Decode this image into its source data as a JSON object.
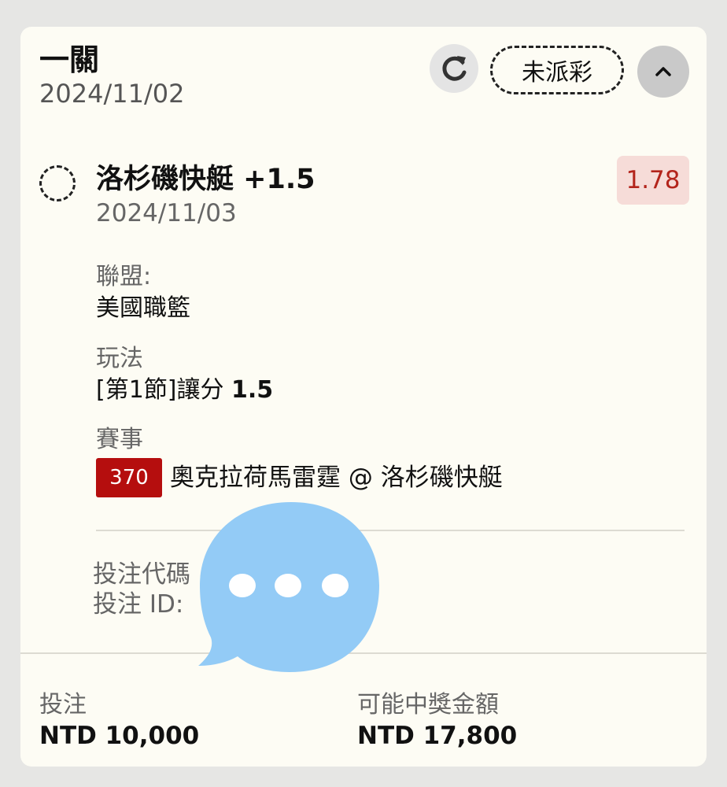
{
  "header": {
    "title": "一關",
    "date": "2024/11/02",
    "status_label": "未派彩",
    "icons": [
      "refresh-icon",
      "chevron-up-icon"
    ]
  },
  "selection": {
    "title": "洛杉磯快艇 +1.5",
    "date": "2024/11/03",
    "odds": "1.78",
    "league_label": "聯盟:",
    "league_value": "美國職籃",
    "bet_type_label": "玩法",
    "bet_type_prefix": "[第1節]讓分 ",
    "bet_type_line": "1.5",
    "event_label": "賽事",
    "event_number": "370",
    "event_name": "奧克拉荷馬雷霆 @ 洛杉磯快艇"
  },
  "meta": {
    "code_label": "投注代碼",
    "id_label": "投注 ID:"
  },
  "footer": {
    "stake_label": "投注",
    "stake_value": "NTD 10,000",
    "payout_label": "可能中獎金額",
    "payout_value": "NTD 17,800"
  },
  "colors": {
    "odds_text": "#b3241b",
    "odds_bg": "#f6dcd8",
    "event_badge": "#b50e0e",
    "overlay_bubble": "#93cbf6"
  }
}
